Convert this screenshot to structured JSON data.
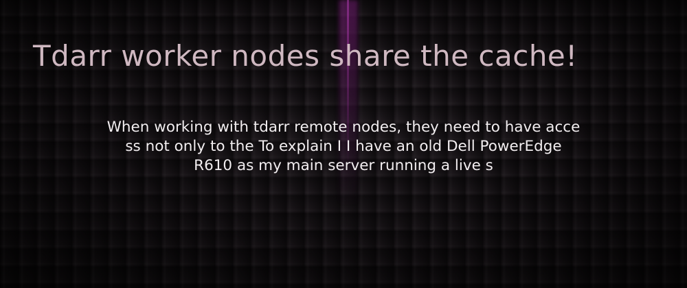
{
  "title": "Tdarr worker nodes share the cache!",
  "description_lines": [
    "When working with tdarr remote nodes, they need to have acce",
    "ss not only to the To explain I I have an old Dell PowerEdge",
    "R610 as my main server running a live s"
  ],
  "colors": {
    "title": "#cfb8c1",
    "body_text": "#f2eef0",
    "background": "#141113",
    "accent_glow": "#a030a0"
  }
}
